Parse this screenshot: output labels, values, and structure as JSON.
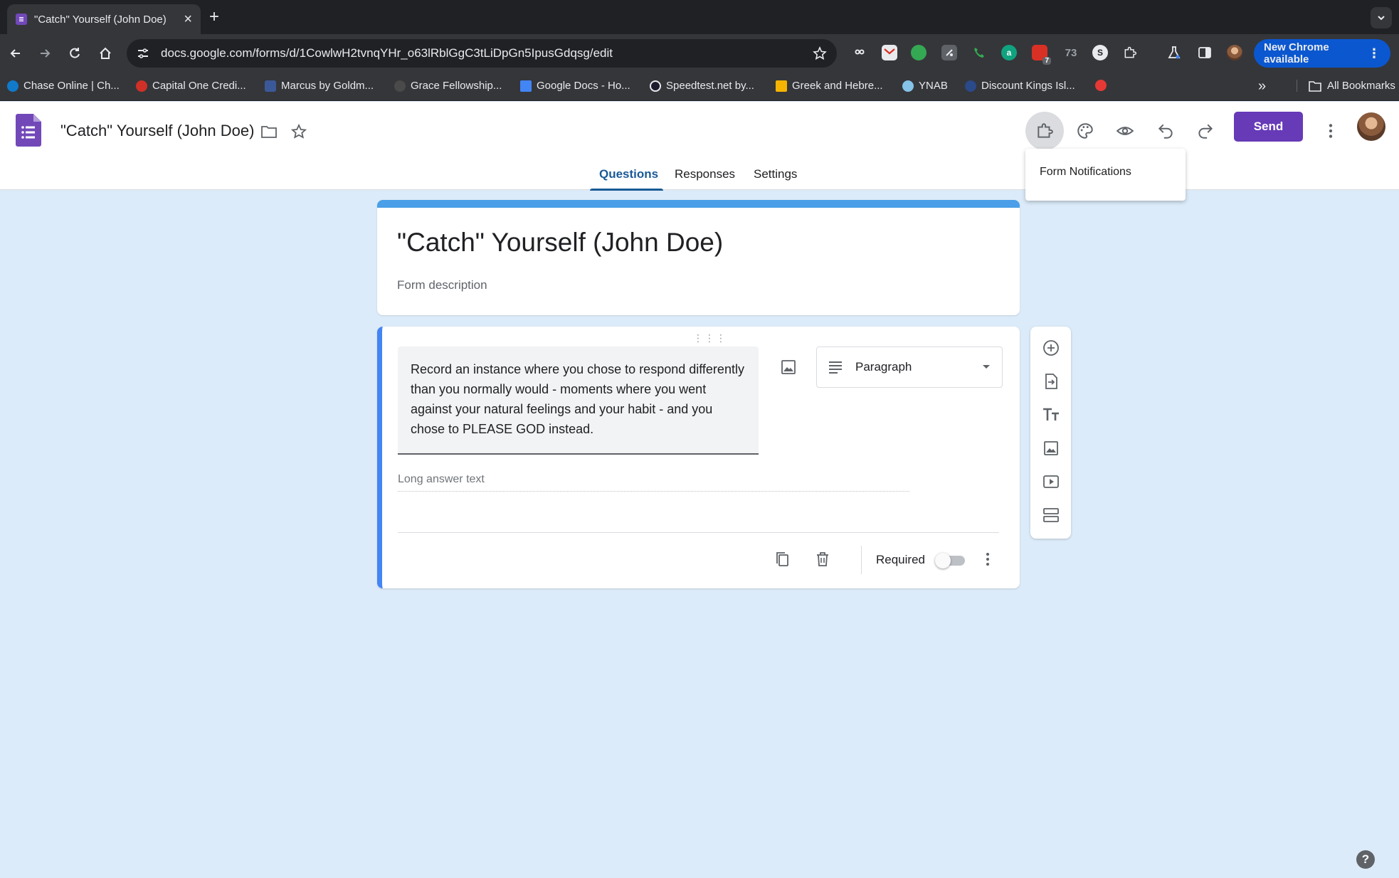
{
  "browser": {
    "tab_title": "\"Catch\" Yourself (John Doe)",
    "tab_close": "×",
    "new_tab": "+",
    "url": "docs.google.com/forms/d/1CowlwH2tvnqYHr_o63lRblGgC3tLiDpGn5IpusGdqsg/edit",
    "extension_badge_count": "7",
    "extension_count_text": "73",
    "new_chrome_label": "New Chrome available",
    "new_chrome_menu": "⋮"
  },
  "bookmarks": {
    "items": [
      {
        "label": "Chase Online | Ch...",
        "color": "#117aca"
      },
      {
        "label": "Capital One Credi...",
        "color": "#d03027"
      },
      {
        "label": "Marcus by Goldm...",
        "color": "#3b5998"
      },
      {
        "label": "Grace Fellowship...",
        "color": "#4a4a4a"
      },
      {
        "label": "Google Docs - Ho...",
        "color": "#4285f4"
      },
      {
        "label": "Speedtest.net by...",
        "color": "#1c1c2e"
      },
      {
        "label": "Greek and Hebre...",
        "color": "#f5b400"
      },
      {
        "label": "YNAB",
        "color": "#85c3e9"
      },
      {
        "label": "Discount Kings Isl...",
        "color": "#2a4a8a"
      },
      {
        "label": "",
        "color": "#e53935"
      }
    ],
    "more": "»",
    "all_bookmarks": "All Bookmarks"
  },
  "header": {
    "doc_title": "\"Catch\" Yourself (John Doe)",
    "send_label": "Send",
    "tabs": [
      "Questions",
      "Responses",
      "Settings"
    ],
    "tooltip": "Form Notifications"
  },
  "form": {
    "title": "\"Catch\" Yourself (John Doe)",
    "description_placeholder": "Form description",
    "question": {
      "text": "Record an instance where you chose to respond differently than you normally would - moments where you went against your natural feelings and your habit - and you chose to PLEASE GOD instead.",
      "type_label": "Paragraph",
      "answer_placeholder": "Long answer text",
      "required_label": "Required",
      "required": false
    }
  },
  "help_label": "?",
  "colors": {
    "accent": "#673ab7",
    "form_bg": "#dcebf9",
    "title_bar": "#4a9fe8",
    "active_card": "#4285f4"
  }
}
